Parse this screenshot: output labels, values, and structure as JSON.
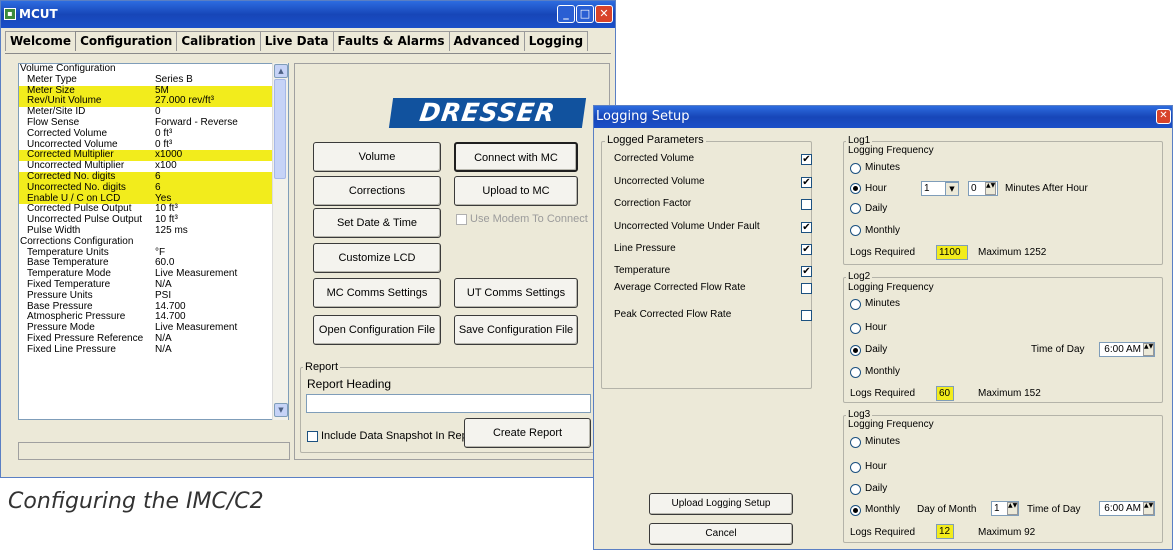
{
  "mcut": {
    "title": "MCUT",
    "icon": "app-icon",
    "tabs": [
      "Welcome",
      "Configuration",
      "Calibration",
      "Live Data",
      "Faults & Alarms",
      "Advanced",
      "Logging"
    ],
    "active_tab": "Configuration",
    "config_list": [
      {
        "k": "Volume Configuration",
        "v": "",
        "header": true
      },
      {
        "k": "Meter Type",
        "v": "Series B"
      },
      {
        "k": "Meter Size",
        "v": "5M",
        "hl": true
      },
      {
        "k": "Rev/Unit Volume",
        "v": "27.000 rev/ft³",
        "hl": true
      },
      {
        "k": "Meter/Site ID",
        "v": "0"
      },
      {
        "k": "Flow Sense",
        "v": "Forward - Reverse"
      },
      {
        "k": "Corrected Volume",
        "v": "0 ft³"
      },
      {
        "k": "Uncorrected Volume",
        "v": "0 ft³"
      },
      {
        "k": "Corrected Multiplier",
        "v": "x1000",
        "hl": true
      },
      {
        "k": "Uncorrected Multiplier",
        "v": "x100"
      },
      {
        "k": "Corrected No. digits",
        "v": "6",
        "hl": true
      },
      {
        "k": "Uncorrected No. digits",
        "v": "6",
        "hl": true
      },
      {
        "k": "Enable U / C on LCD",
        "v": "Yes",
        "hl": true
      },
      {
        "k": "Corrected Pulse Output",
        "v": "10 ft³"
      },
      {
        "k": "Uncorrected Pulse Output",
        "v": "10 ft³"
      },
      {
        "k": "Pulse Width",
        "v": "125 ms"
      },
      {
        "k": "Corrections Configuration",
        "v": "",
        "header": true
      },
      {
        "k": "Temperature Units",
        "v": "°F"
      },
      {
        "k": "Base Temperature",
        "v": "60.0"
      },
      {
        "k": "Temperature Mode",
        "v": "Live Measurement"
      },
      {
        "k": "Fixed Temperature",
        "v": "N/A"
      },
      {
        "k": "Pressure Units",
        "v": "PSI"
      },
      {
        "k": "Base Pressure",
        "v": "14.700"
      },
      {
        "k": "Atmospheric Pressure",
        "v": "14.700"
      },
      {
        "k": "Pressure Mode",
        "v": "Live Measurement"
      },
      {
        "k": "Fixed Pressure Reference",
        "v": "N/A"
      },
      {
        "k": "Fixed Line Pressure",
        "v": "N/A"
      }
    ],
    "logo": "DRESSER",
    "buttons": {
      "volume": "Volume",
      "connect": "Connect with MC",
      "corrections": "Corrections",
      "upload": "Upload to MC",
      "setdate": "Set Date & Time",
      "use_modem": "Use Modem To Connect",
      "customize": "Customize LCD",
      "mc_comms": "MC Comms Settings",
      "ut_comms": "UT Comms Settings",
      "open_config": "Open Configuration File",
      "save_config": "Save Configuration File",
      "create_report": "Create Report"
    },
    "report": {
      "group": "Report",
      "heading_label": "Report Heading",
      "heading_value": "",
      "include_snapshot": "Include Data Snapshot In Report"
    }
  },
  "caption": "Configuring the IMC/C2",
  "logging": {
    "title": "Logging Setup",
    "params_title": "Logged Parameters",
    "params": [
      {
        "label": "Corrected Volume",
        "checked": true
      },
      {
        "label": "Uncorrected Volume",
        "checked": true
      },
      {
        "label": "Correction Factor",
        "checked": false
      },
      {
        "label": "Uncorrected Volume Under Fault",
        "checked": true
      },
      {
        "label": "Line Pressure",
        "checked": true
      },
      {
        "label": "Temperature",
        "checked": true
      },
      {
        "label": "Average Corrected Flow Rate",
        "checked": false
      },
      {
        "label": "Peak Corrected Flow Rate",
        "checked": false
      }
    ],
    "upload_button": "Upload Logging Setup",
    "cancel_button": "Cancel",
    "freq_label": "Logging Frequency",
    "options": {
      "minutes": "Minutes",
      "hour": "Hour",
      "daily": "Daily",
      "monthly": "Monthly"
    },
    "logs_required_label": "Logs Required",
    "log1": {
      "title": "Log1",
      "selected": "Hour",
      "hour_value": "1",
      "minutes_value": "0",
      "minutes_after": "Minutes After Hour",
      "logs_required": "1100",
      "maximum": "Maximum 1252"
    },
    "log2": {
      "title": "Log2",
      "selected": "Daily",
      "time_label": "Time of Day",
      "time_value": "6:00 AM",
      "logs_required": "60",
      "maximum": "Maximum 152"
    },
    "log3": {
      "title": "Log3",
      "selected": "Monthly",
      "day_label": "Day of Month",
      "day_value": "1",
      "time_label": "Time of Day",
      "time_value": "6:00 AM",
      "logs_required": "12",
      "maximum": "Maximum 92"
    }
  }
}
